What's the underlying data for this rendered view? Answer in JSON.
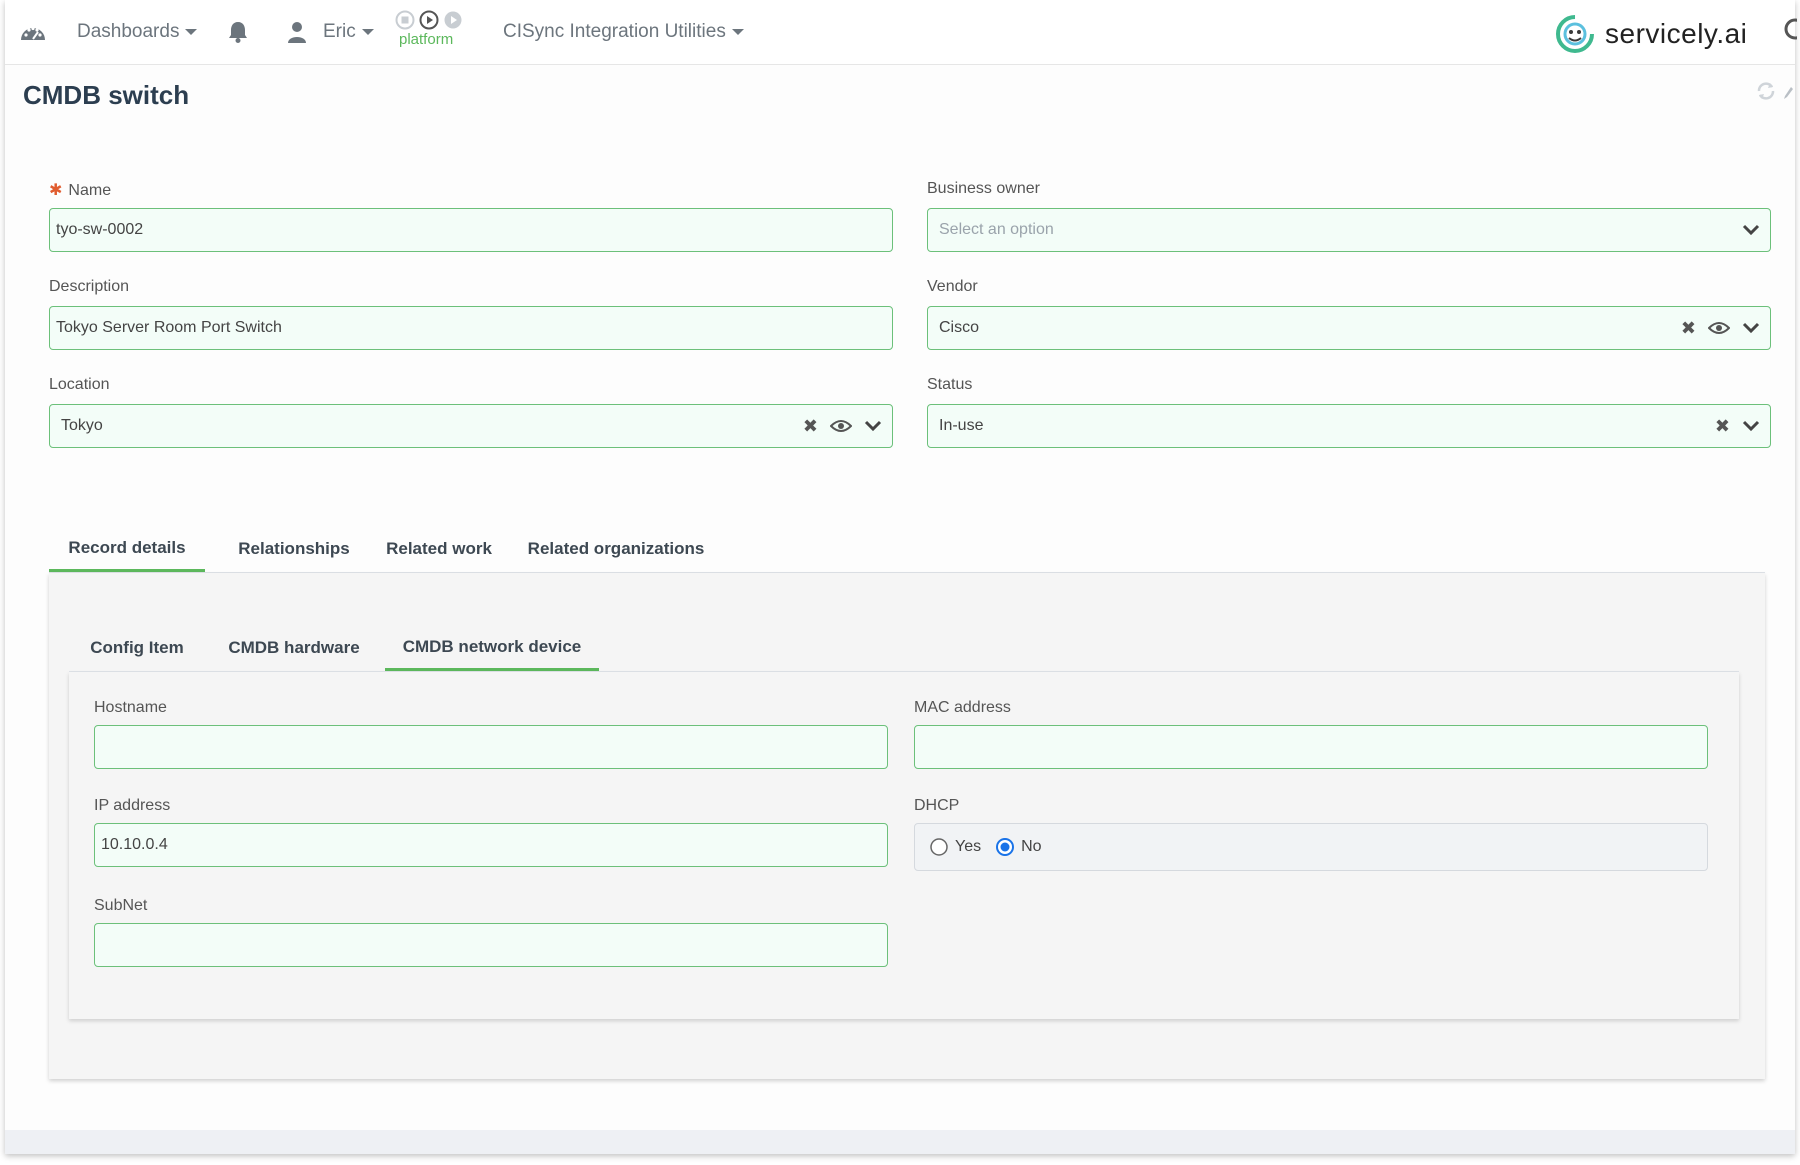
{
  "nav": {
    "dashboards_label": "Dashboards",
    "user_label": "Eric",
    "platform_label": "platform",
    "utilities_label": "CISync Integration Utilities",
    "brand_name": "servicely.ai"
  },
  "page": {
    "title": "CMDB switch"
  },
  "form": {
    "name": {
      "label": "Name",
      "value": "tyo-sw-0002"
    },
    "business_owner": {
      "label": "Business owner",
      "placeholder": "Select an option"
    },
    "description": {
      "label": "Description",
      "value": "Tokyo Server Room Port Switch"
    },
    "vendor": {
      "label": "Vendor",
      "value": "Cisco"
    },
    "location": {
      "label": "Location",
      "value": "Tokyo"
    },
    "status": {
      "label": "Status",
      "value": "In-use"
    }
  },
  "tabs": [
    {
      "label": "Record details"
    },
    {
      "label": "Relationships"
    },
    {
      "label": "Related work"
    },
    {
      "label": "Related organizations"
    }
  ],
  "subtabs": [
    {
      "label": "Config Item"
    },
    {
      "label": "CMDB hardware"
    },
    {
      "label": "CMDB network device"
    }
  ],
  "network": {
    "hostname": {
      "label": "Hostname",
      "value": ""
    },
    "mac_address": {
      "label": "MAC address",
      "value": ""
    },
    "ip_address": {
      "label": "IP address",
      "value": "10.10.0.4"
    },
    "dhcp": {
      "label": "DHCP",
      "options": [
        "Yes",
        "No"
      ],
      "selected": "No"
    },
    "subnet": {
      "label": "SubNet",
      "value": ""
    }
  },
  "colors": {
    "accent": "#5cb85c",
    "field_border": "#6cc07a",
    "field_bg": "#f3fdf8",
    "required": "#e05c2f"
  }
}
